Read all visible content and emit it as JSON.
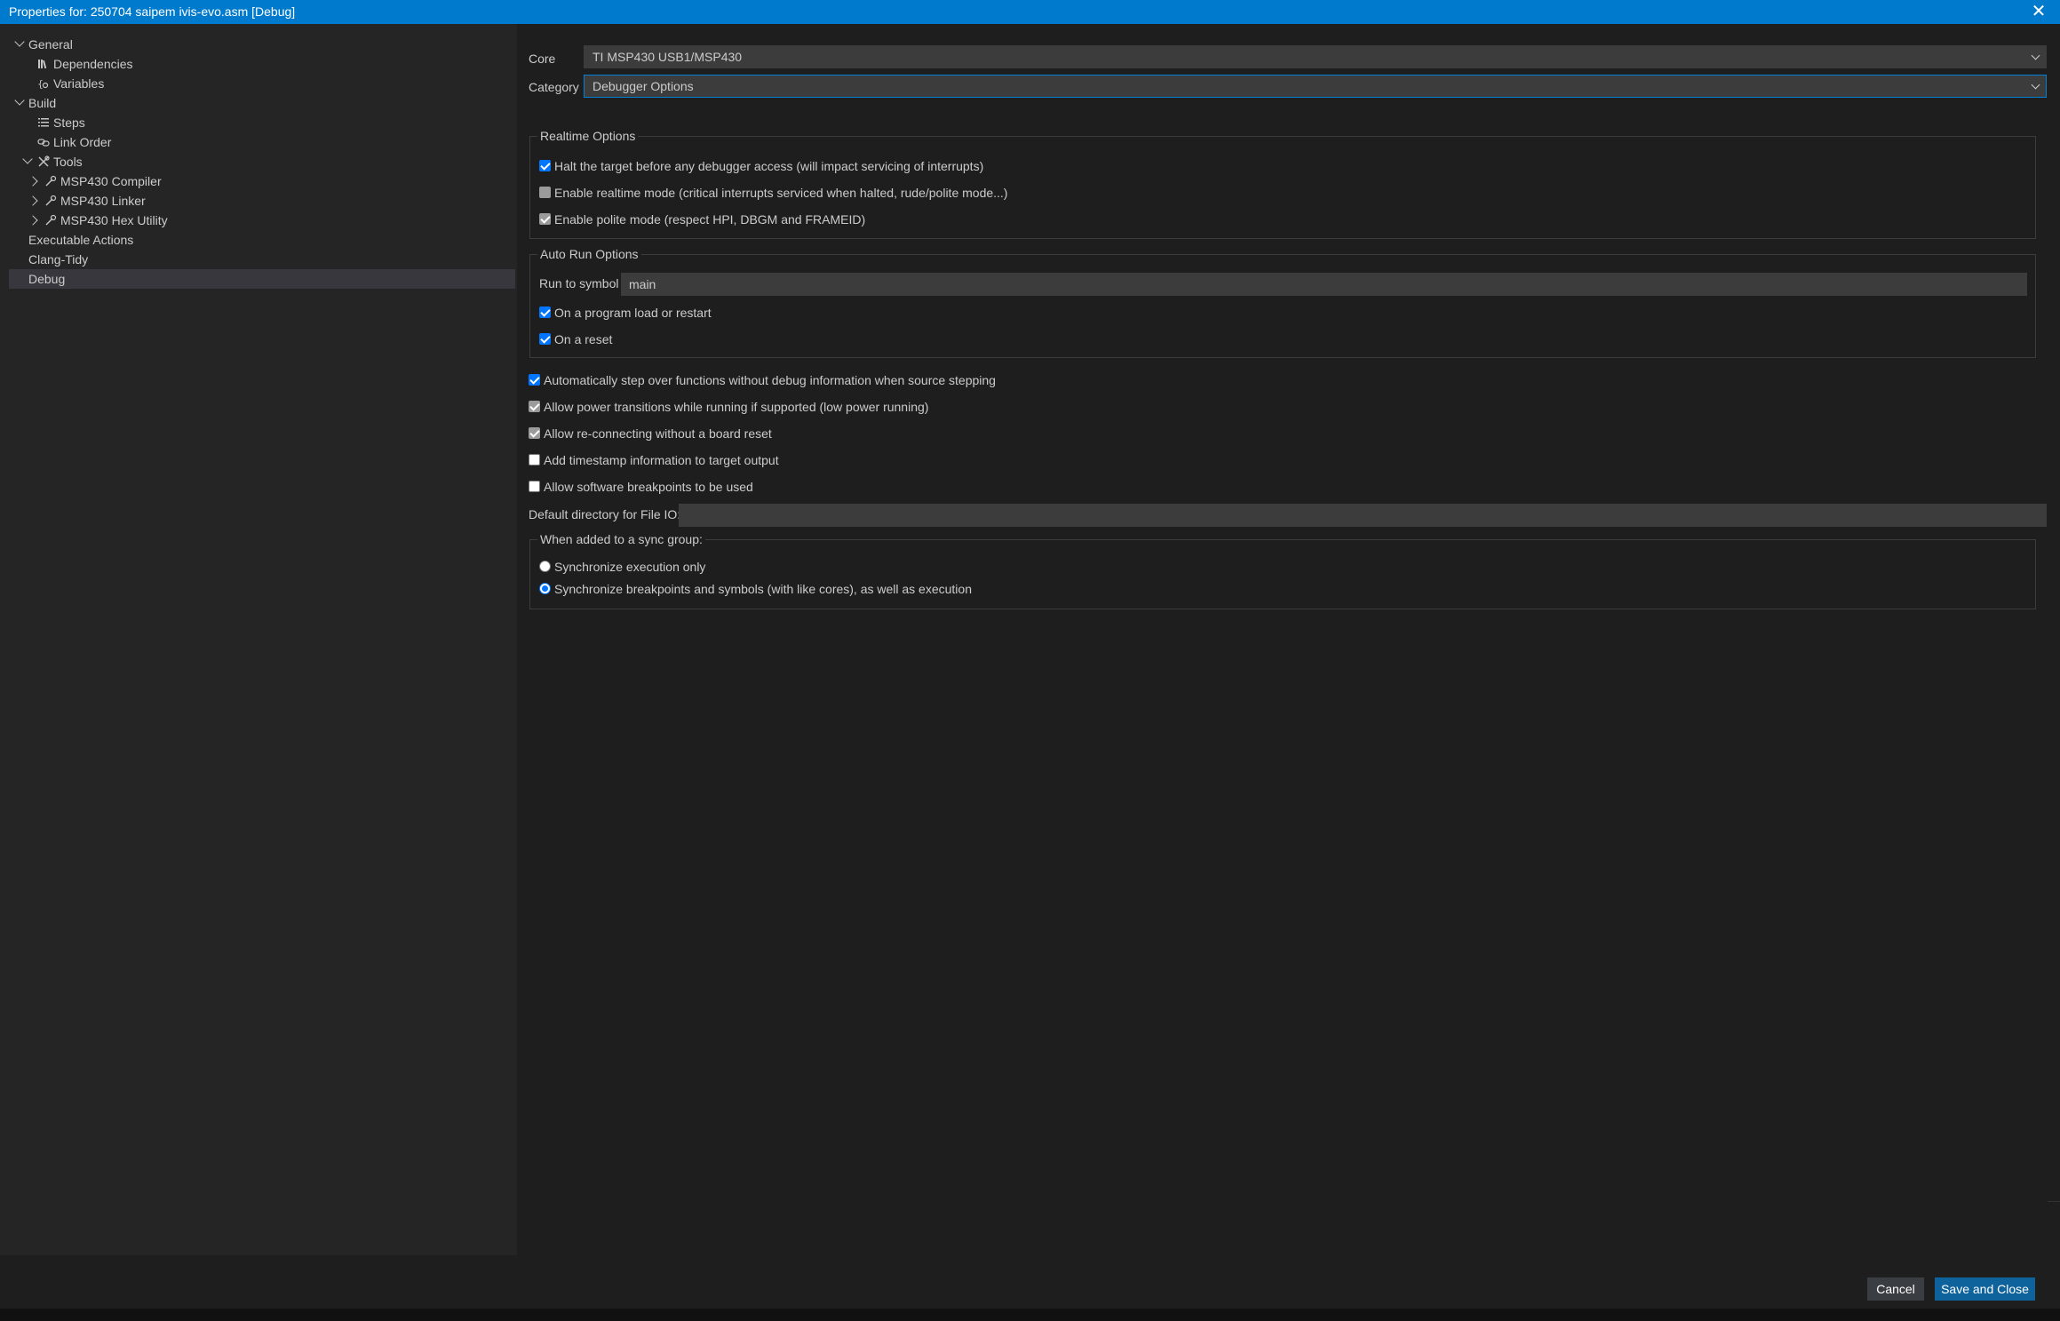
{
  "window": {
    "title": "Properties for: 250704 saipem ivis-evo.asm [Debug]"
  },
  "sidebar": {
    "items": [
      {
        "label": "General"
      },
      {
        "label": "Dependencies"
      },
      {
        "label": "Variables"
      },
      {
        "label": "Build"
      },
      {
        "label": "Steps"
      },
      {
        "label": "Link Order"
      },
      {
        "label": "Tools"
      },
      {
        "label": "MSP430 Compiler"
      },
      {
        "label": "MSP430 Linker"
      },
      {
        "label": "MSP430 Hex Utility"
      },
      {
        "label": "Executable Actions"
      },
      {
        "label": "Clang-Tidy"
      },
      {
        "label": "Debug"
      }
    ],
    "selected": "Debug"
  },
  "header": {
    "core_label": "Core",
    "core_value": "TI MSP430 USB1/MSP430",
    "category_label": "Category",
    "category_value": "Debugger Options"
  },
  "realtime": {
    "legend": "Realtime Options",
    "halt": {
      "label": "Halt the target before any debugger access (will impact servicing of interrupts)",
      "checked": true
    },
    "realtime_mode": {
      "label": "Enable realtime mode (critical interrupts serviced when halted, rude/polite mode...)",
      "checked": false
    },
    "polite": {
      "label": "Enable polite mode (respect HPI, DBGM and FRAMEID)",
      "checked": true
    }
  },
  "autorun": {
    "legend": "Auto Run Options",
    "run_to_symbol_label": "Run to symbol",
    "run_to_symbol_value": "main",
    "on_load": {
      "label": "On a program load or restart",
      "checked": true
    },
    "on_reset": {
      "label": "On a reset",
      "checked": true
    }
  },
  "options": {
    "auto_step": {
      "label": "Automatically step over functions without debug information when source stepping",
      "checked": true
    },
    "power": {
      "label": "Allow power transitions while running if supported (low power running)",
      "checked": true
    },
    "reconnect": {
      "label": "Allow re-connecting without a board reset",
      "checked": true
    },
    "timestamp": {
      "label": "Add timestamp information to target output",
      "checked": false
    },
    "sw_breakpoints": {
      "label": "Allow software breakpoints to be used",
      "checked": false
    },
    "file_io_label": "Default directory for File IO:",
    "file_io_value": ""
  },
  "sync": {
    "legend": "When added to a sync group:",
    "exec_only": "Synchronize execution only",
    "breakpoints": "Synchronize breakpoints and symbols (with like cores), as well as execution",
    "selected": "breakpoints"
  },
  "footer": {
    "cancel_label": "Cancel",
    "save_label": "Save and Close"
  },
  "colors": {
    "accent": "#007acc",
    "primary_button": "#0e639c",
    "checkbox": "#0075ff"
  }
}
